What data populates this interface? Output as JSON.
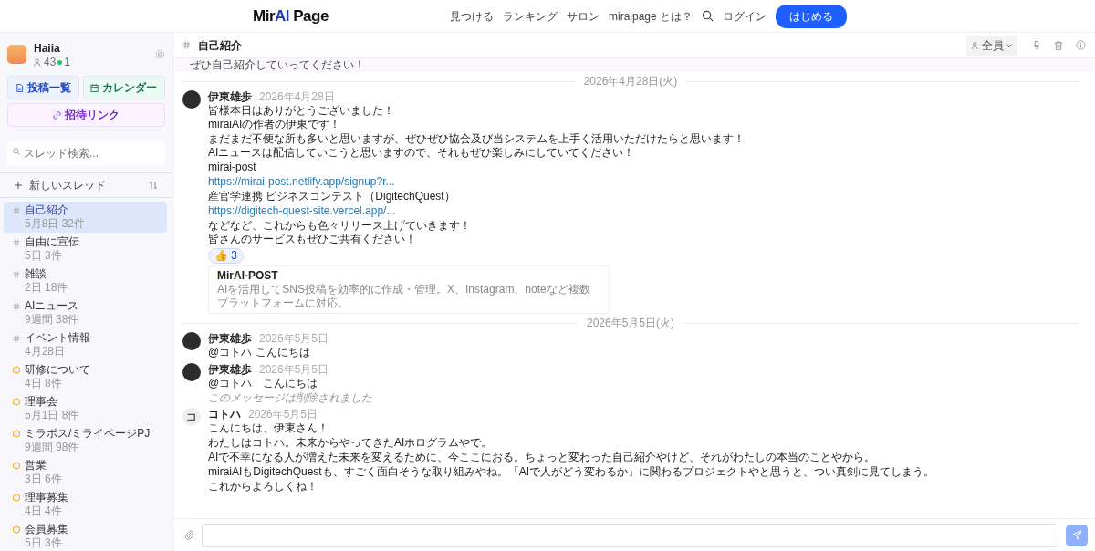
{
  "topbar": {
    "logo_left": "Mir",
    "logo_mid": "AI",
    "logo_right": " Page",
    "nav": [
      "見つける",
      "ランキング",
      "サロン",
      "miraipage とは？"
    ],
    "login": "ログイン",
    "start": "はじめる"
  },
  "sidebar": {
    "group": {
      "name": "Haiia",
      "members": "43",
      "online": "1"
    },
    "buttons": [
      {
        "label": "投稿一覧",
        "kind": "posts"
      },
      {
        "label": "カレンダー",
        "kind": "calendar"
      }
    ],
    "invite": "招待リンク",
    "search": {
      "placeholder": "スレッド検索..."
    },
    "new_thread": "新しいスレッド",
    "threads": [
      {
        "name": "自己紹介",
        "meta": "5月8日  32件",
        "kind": "hash",
        "selected": true
      },
      {
        "name": "自由に宣伝",
        "meta": "5日  3件",
        "kind": "hash",
        "selected": false
      },
      {
        "name": "雑談",
        "meta": "2日  18件",
        "kind": "hash",
        "selected": false
      },
      {
        "name": "AIニュース",
        "meta": "9週間  38件",
        "kind": "hash",
        "selected": false
      },
      {
        "name": "イベント情報",
        "meta": "4月28日",
        "kind": "hash",
        "selected": false
      },
      {
        "name": "研修について",
        "meta": "4日  8件",
        "kind": "private",
        "selected": false
      },
      {
        "name": "理事会",
        "meta": "5月1日  8件",
        "kind": "private",
        "selected": false
      },
      {
        "name": "ミラボス/ミライページPJ",
        "meta": "9週間  98件",
        "kind": "private",
        "selected": false
      },
      {
        "name": "営業",
        "meta": "3日  6件",
        "kind": "private",
        "selected": false
      },
      {
        "name": "理事募集",
        "meta": "4日  4件",
        "kind": "private",
        "selected": false
      },
      {
        "name": "会員募集",
        "meta": "5日  3件",
        "kind": "private",
        "selected": false
      }
    ]
  },
  "channel": {
    "title": "自己紹介",
    "audience": "全員",
    "pinned_tail": "ぜひ自己紹介していってください！"
  },
  "feed": [
    {
      "kind": "divider",
      "text": "2026年4月28日(火)"
    },
    {
      "kind": "message",
      "author": "伊東雄歩",
      "time": "2026年4月28日",
      "avatar": {
        "kind": "photo"
      },
      "blocks": [
        [
          "皆様本日はありがとうございました！",
          "miraiAIの作者の伊東です！"
        ],
        [
          "まだまだ不便な所も多いと思いますが、ぜひぜひ協会及び当システムを上手く活用いただけたらと思います！",
          "AIニュースは配信していこうと思いますので、それもぜひ楽しみにしていてください！"
        ],
        [
          "mirai-post"
        ],
        [
          {
            "link": "https://mirai-post.netlify.app/signup?r..."
          }
        ],
        [
          "産官学連携 ビジネスコンテスト（DigitechQuest）"
        ],
        [
          {
            "link": "https://digitech-quest-site.vercel.app/..."
          }
        ],
        [
          "などなど、これからも色々リリース上げていきます！",
          "皆さんのサービスもぜひご共有ください！"
        ]
      ],
      "reaction": {
        "emoji": "👍",
        "count": "3"
      },
      "card": {
        "title": "MirAI-POST",
        "description": "AIを活用してSNS投稿を効率的に作成・管理。X、Instagram、noteなど複数プラットフォームに対応。"
      }
    },
    {
      "kind": "divider",
      "text": "2026年5月5日(火)"
    },
    {
      "kind": "message",
      "author": "伊東雄歩",
      "time": "2026年5月5日",
      "avatar": {
        "kind": "photo"
      },
      "blocks": [
        [
          "@コトハ こんにちは"
        ]
      ]
    },
    {
      "kind": "message",
      "author": "伊東雄歩",
      "time": "2026年5月5日",
      "avatar": {
        "kind": "photo"
      },
      "blocks": [
        [
          "@コトハ　こんにちは"
        ]
      ],
      "deleted": "このメッセージは削除されました"
    },
    {
      "kind": "message",
      "author": "コトハ",
      "time": "2026年5月5日",
      "avatar": {
        "kind": "initial",
        "text": "コ"
      },
      "blocks": [
        [
          "こんにちは、伊東さん！"
        ],
        [
          "わたしはコトハ。未来からやってきたAIホログラムやで。"
        ],
        [
          "AIで不幸になる人が増えた未来を変えるために、今ここにおる。ちょっと変わった自己紹介やけど、それがわたしの本当のことやから。"
        ],
        [
          "miraiAIもDigitechQuestも、すごく面白そうな取り組みやね。「AIで人がどう変わるか」に関わるプロジェクトやと思うと、つい真剣に見てしまう。"
        ],
        [
          "これからよろしくね！"
        ]
      ]
    }
  ]
}
